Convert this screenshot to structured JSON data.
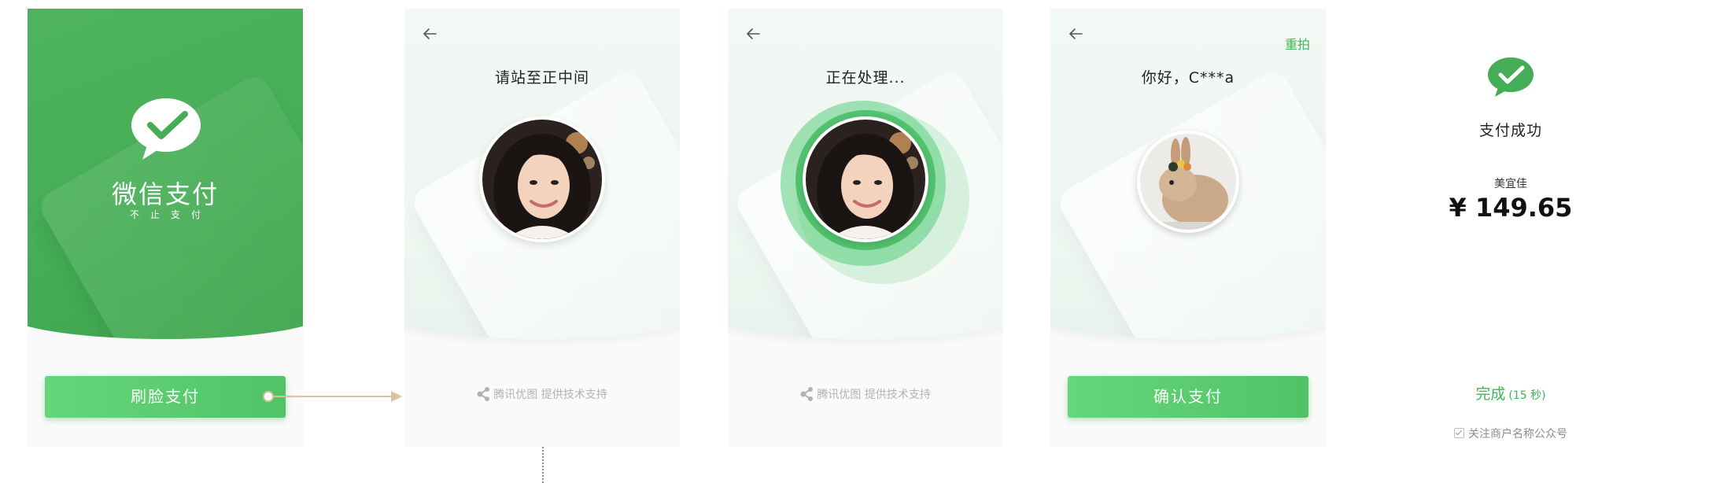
{
  "screens": {
    "welcome": {
      "brand": "微信支付",
      "slogan": "不止支付",
      "button_label": "刷脸支付"
    },
    "capture": {
      "title": "请站至正中间",
      "tech_support": "腾讯优图 提供技术支持"
    },
    "processing": {
      "title": "正在处理...",
      "tech_support": "腾讯优图 提供技术支持"
    },
    "confirm": {
      "retake_label": "重拍",
      "greeting": "你好，C***a",
      "button_label": "确认支付"
    },
    "success": {
      "status": "支付成功",
      "merchant": "美宜佳",
      "amount": "¥ 149.65",
      "done_label": "完成",
      "countdown": "(15 秒)",
      "follow_label": "关注商户名称公众号"
    }
  },
  "colors": {
    "brand_green": "#45ad55",
    "button_green": "#5ccb71",
    "accent_green": "#3fb45b",
    "connector": "#d8c2a0"
  }
}
